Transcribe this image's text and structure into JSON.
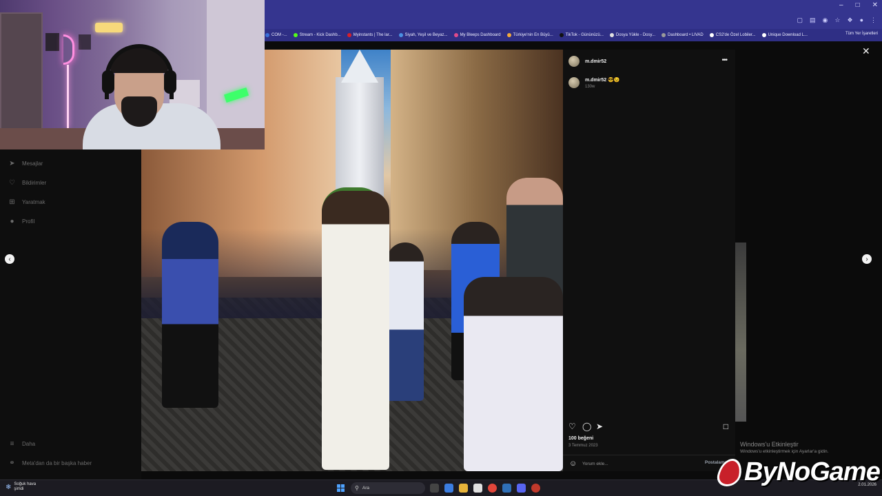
{
  "bookmarks": [
    {
      "label": "COM -...",
      "color": "#3a6fd8"
    },
    {
      "label": "Stream - Kick Dashb...",
      "color": "#53fc18"
    },
    {
      "label": "Myinstants | The lar...",
      "color": "#d81f2a"
    },
    {
      "label": "Siyah, Yeşil ve Beyaz...",
      "color": "#4a90e2"
    },
    {
      "label": "My Bleeps Dashboard",
      "color": "#e04a8b"
    },
    {
      "label": "Türkiye'nin En Büyü...",
      "color": "#f2a93b"
    },
    {
      "label": "TikTok - Gününüzü...",
      "color": "#111111"
    },
    {
      "label": "Dosya Yükle - Dosy...",
      "color": "#e0e0e0"
    },
    {
      "label": "Dashboard • LIVAD",
      "color": "#9a9a9a"
    },
    {
      "label": "CS2'de Özel Lobiler...",
      "color": "#ffffff"
    },
    {
      "label": "Unique Download L...",
      "color": "#ffffff"
    }
  ],
  "bookmarks_end": "Tüm Yer İşaretleri",
  "sidebar": {
    "items": [
      {
        "label": "Mesajlar",
        "icon": "messenger-icon"
      },
      {
        "label": "Bildirimler",
        "icon": "heart-icon"
      },
      {
        "label": "Yaratmak",
        "icon": "plus-square-icon"
      },
      {
        "label": "Profil",
        "icon": "profile-icon"
      }
    ],
    "bottom": [
      {
        "label": "Daha",
        "icon": "menu-icon"
      },
      {
        "label": "Meta'dan da bir başka haber",
        "icon": "meta-icon"
      }
    ]
  },
  "post": {
    "username": "m.dmir52",
    "caption": "m.dmir52 😎😉",
    "caption_time": "130w",
    "likes": "100 beğeni",
    "date": "3 Temmuz 2023",
    "comment_placeholder": "Yorum ekle...",
    "post_button": "Postalamak"
  },
  "activation": {
    "title": "Windows'u Etkinleştir",
    "subtitle": "Windows'u etkinleştirmek için Ayarlar'a gidin."
  },
  "taskbar": {
    "weather_line1": "Soğuk hava",
    "weather_line2": "şimdi",
    "search_label": "Ara",
    "date": "2.01.2026"
  },
  "logo_text": "ByNoGame"
}
